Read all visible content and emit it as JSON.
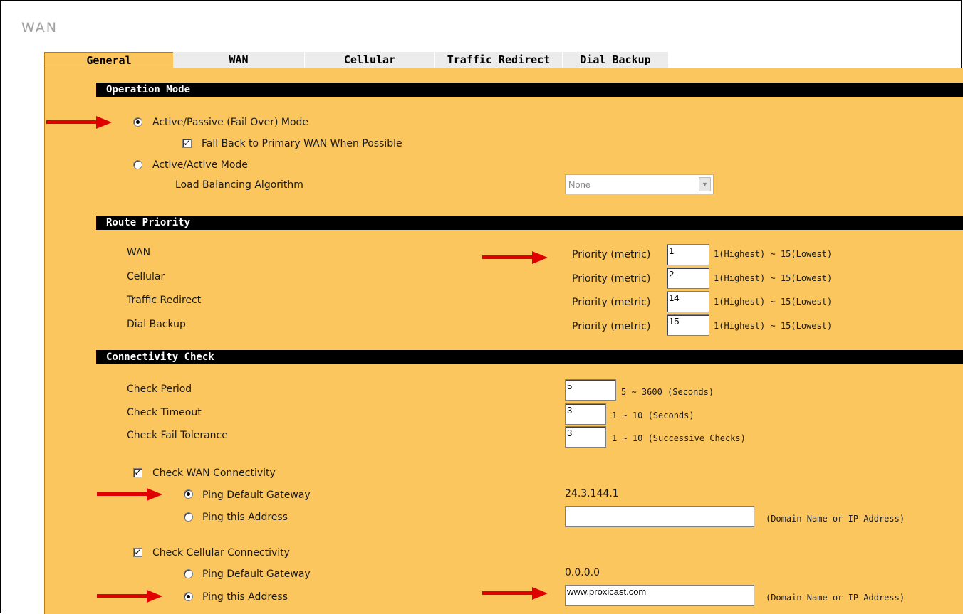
{
  "page": {
    "title": "WAN"
  },
  "tabs": [
    {
      "label": "General"
    },
    {
      "label": "WAN"
    },
    {
      "label": "Cellular"
    },
    {
      "label": "Traffic Redirect"
    },
    {
      "label": "Dial Backup"
    }
  ],
  "operation_mode": {
    "header": "Operation Mode",
    "active_passive_label": "Active/Passive (Fail Over) Mode",
    "fallback_label": "Fall Back to Primary WAN When Possible",
    "active_active_label": "Active/Active Mode",
    "algorithm_label": "Load Balancing Algorithm",
    "algorithm_value": "None"
  },
  "route_priority": {
    "header": "Route Priority",
    "rows": [
      {
        "name": "WAN",
        "metric_label": "Priority (metric)",
        "value": "1",
        "range": "1(Highest) ~ 15(Lowest)"
      },
      {
        "name": "Cellular",
        "metric_label": "Priority (metric)",
        "value": "2",
        "range": "1(Highest) ~ 15(Lowest)"
      },
      {
        "name": "Traffic Redirect",
        "metric_label": "Priority (metric)",
        "value": "14",
        "range": "1(Highest) ~ 15(Lowest)"
      },
      {
        "name": "Dial Backup",
        "metric_label": "Priority (metric)",
        "value": "15",
        "range": "1(Highest) ~ 15(Lowest)"
      }
    ]
  },
  "connectivity": {
    "header": "Connectivity Check",
    "check_period_label": "Check Period",
    "check_period_value": "5",
    "check_period_range": "5 ~ 3600 (Seconds)",
    "check_timeout_label": "Check Timeout",
    "check_timeout_value": "3",
    "check_timeout_range": "1 ~ 10 (Seconds)",
    "fail_tolerance_label": "Check Fail Tolerance",
    "fail_tolerance_value": "3",
    "fail_tolerance_range": "1 ~ 10 (Successive Checks)",
    "wan_check_label": "Check WAN Connectivity",
    "wan_ping_gateway_label": "Ping Default Gateway",
    "wan_gateway_value": "24.3.144.1",
    "wan_ping_address_label": "Ping this Address",
    "wan_address_value": "",
    "wan_address_hint": "(Domain Name or IP Address)",
    "cell_check_label": "Check Cellular Connectivity",
    "cell_ping_gateway_label": "Ping Default Gateway",
    "cell_gateway_value": "0.0.0.0",
    "cell_ping_address_label": "Ping this Address",
    "cell_address_value": "www.proxicast.com",
    "cell_address_hint": "(Domain Name or IP Address)"
  },
  "colors": {
    "panel": "#fcc65e",
    "header": "#000000",
    "arrow": "#e00000"
  }
}
